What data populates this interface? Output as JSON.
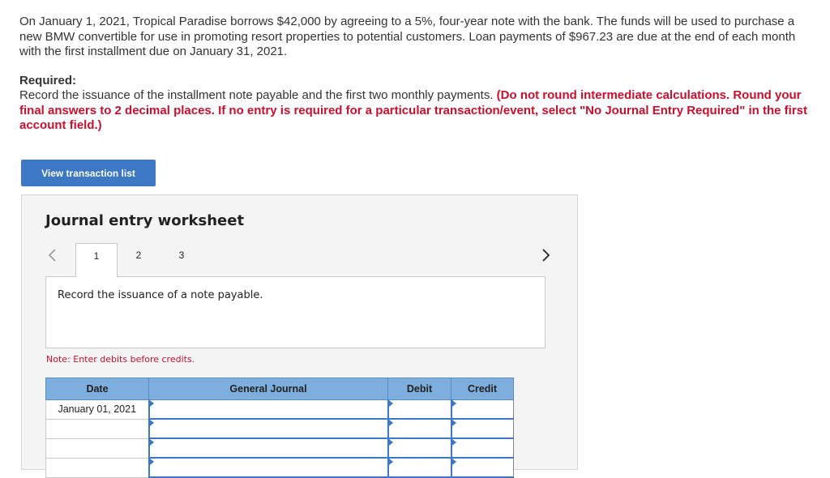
{
  "problem": {
    "text": "On January 1, 2021, Tropical Paradise borrows $42,000 by agreeing to a 5%, four-year note with the bank. The funds will be used to purchase a new BMW convertible for use in promoting resort properties to potential customers. Loan payments of $967.23 are due at the end of each month with the first installment due on January 31, 2021."
  },
  "required": {
    "heading": "Required:",
    "text": "Record the issuance of the installment note payable and the first two monthly payments. ",
    "instructions": "(Do not round intermediate calculations. Round your final answers to 2 decimal places. If no entry is required for a particular transaction/event, select \"No Journal Entry Required\" in the first account field.)"
  },
  "buttons": {
    "view_transactions": "View transaction list"
  },
  "worksheet": {
    "title": "Journal entry worksheet",
    "tabs": [
      "1",
      "2",
      "3"
    ],
    "active_tab": "1",
    "description": "Record the issuance of a note payable.",
    "note": "Note: Enter debits before credits.",
    "table": {
      "headers": {
        "date": "Date",
        "general_journal": "General Journal",
        "debit": "Debit",
        "credit": "Credit"
      },
      "rows": [
        {
          "date": "January 01, 2021",
          "account": "",
          "debit": "",
          "credit": ""
        },
        {
          "date": "",
          "account": "",
          "debit": "",
          "credit": ""
        },
        {
          "date": "",
          "account": "",
          "debit": "",
          "credit": ""
        },
        {
          "date": "",
          "account": "",
          "debit": "",
          "credit": ""
        }
      ]
    }
  },
  "icons": {
    "prev": "chevron-left-icon",
    "next": "chevron-right-icon"
  },
  "colors": {
    "button_blue": "#3c78c3",
    "header_blue": "#7eaedd",
    "required_red": "#c8102e"
  }
}
